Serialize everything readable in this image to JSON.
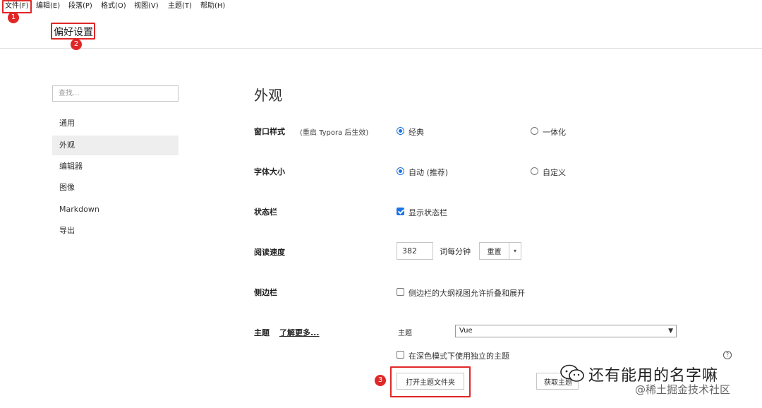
{
  "menubar": {
    "items": [
      "文件(F)",
      "编辑(E)",
      "段落(P)",
      "格式(O)",
      "视图(V)",
      "主题(T)",
      "帮助(H)"
    ]
  },
  "annotations": {
    "badge1": "1",
    "badge2": "2",
    "badge3": "3"
  },
  "header": {
    "title": "偏好设置"
  },
  "sidebar": {
    "search_placeholder": "查找...",
    "items": [
      "通用",
      "外观",
      "编辑器",
      "图像",
      "Markdown",
      "导出"
    ],
    "active": "外观"
  },
  "main": {
    "title": "外观",
    "window_style": {
      "label": "窗口样式",
      "note": "(重启 Typora 后生效)",
      "options": [
        "经典",
        "一体化"
      ],
      "selected": "经典"
    },
    "font_size": {
      "label": "字体大小",
      "options": [
        "自动 (推荐)",
        "自定义"
      ],
      "selected": "自动 (推荐)"
    },
    "status_bar": {
      "label": "状态栏",
      "checkbox_label": "显示状态栏",
      "checked": true
    },
    "reading_speed": {
      "label": "阅读速度",
      "value": "382",
      "unit": "词每分钟",
      "reset_label": "重置",
      "dropdown_glyph": "▾"
    },
    "sidebar_setting": {
      "label": "侧边栏",
      "checkbox_label": "侧边栏的大纲视图允许折叠和展开",
      "checked": false
    },
    "theme": {
      "label": "主题",
      "learn_more": "了解更多...",
      "select_label": "主题",
      "selected_theme": "Vue",
      "dark_mode_checkbox": "在深色模式下使用独立的主题",
      "dark_mode_checked": false,
      "open_folder_button": "打开主题文件夹",
      "get_theme_button": "获取主题",
      "help_glyph": "?"
    }
  },
  "watermark": {
    "main": "还有能用的名字嘛",
    "sub": "@稀土掘金技术社区"
  },
  "colors": {
    "accent": "#1a73e8",
    "annotation_red": "#e02727",
    "active_bg": "#eeeeee"
  }
}
